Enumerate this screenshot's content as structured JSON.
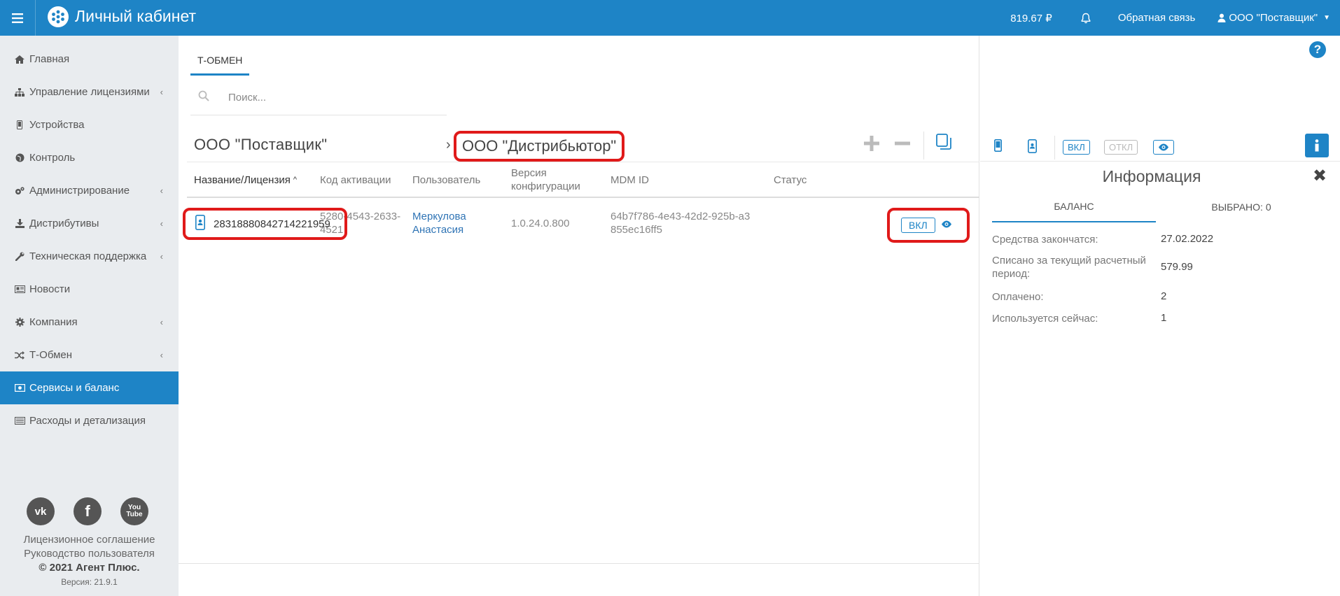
{
  "topbar": {
    "title": "Личный кабинет",
    "balance": "819.67 ₽",
    "feedback": "Обратная связь",
    "user": "ООО \"Поставщик\""
  },
  "sidebar": {
    "items": [
      {
        "label": "Главная",
        "icon": "home-icon",
        "chevron": false
      },
      {
        "label": "Управление лицензиями",
        "icon": "sitemap-icon",
        "chevron": true
      },
      {
        "label": "Устройства",
        "icon": "mobile-icon",
        "chevron": false
      },
      {
        "label": "Контроль",
        "icon": "globe-icon",
        "chevron": false
      },
      {
        "label": "Администрирование",
        "icon": "cogs-icon",
        "chevron": true
      },
      {
        "label": "Дистрибутивы",
        "icon": "download-icon",
        "chevron": true
      },
      {
        "label": "Техническая поддержка",
        "icon": "wrench-icon",
        "chevron": true
      },
      {
        "label": "Новости",
        "icon": "newspaper-icon",
        "chevron": false
      },
      {
        "label": "Компания",
        "icon": "gear-icon",
        "chevron": true
      },
      {
        "label": "Т-Обмен",
        "icon": "random-icon",
        "chevron": true
      },
      {
        "label": "Сервисы и баланс",
        "icon": "money-icon",
        "chevron": false,
        "active": true
      },
      {
        "label": "Расходы и детализация",
        "icon": "list-icon",
        "chevron": false
      }
    ],
    "socials": [
      "vk-icon",
      "facebook-icon",
      "youtube-icon"
    ],
    "footer": {
      "license": "Лицензионное соглашение",
      "guide": "Руководство пользователя",
      "copyright": "© 2021 Агент Плюс.",
      "version": "Версия: 21.9.1"
    }
  },
  "main": {
    "tab": "Т-ОБМЕН",
    "search_placeholder": "Поиск...",
    "breadcrumb_left": "ООО \"Поставщик\"",
    "breadcrumb_sep": "›",
    "breadcrumb_right": "ООО \"Дистрибьютор\"",
    "columns": {
      "name": "Название/Лицензия",
      "code": "Код активации",
      "user": "Пользователь",
      "version": "Версия конфигурации",
      "mdm": "MDM ID",
      "status": "Статус"
    },
    "row": {
      "license": "28318880842714221959",
      "code": "5280-4543-2633-4521",
      "user": "Меркулова Анастасия",
      "version": "1.0.24.0.800",
      "mdm": "64b7f786-4e43-42d2-925b-a3855ec16ff5",
      "status": "ВКЛ"
    }
  },
  "right": {
    "btn_on": "ВКЛ",
    "btn_off": "ОТКЛ",
    "title": "Информация",
    "tab_balance": "БАЛАНС",
    "tab_selected": "ВЫБРАНО: 0",
    "rows": [
      {
        "label": "Средства закончатся:",
        "value": "27.02.2022"
      },
      {
        "label": "Списано за текущий расчетный период:",
        "value": "579.99"
      },
      {
        "label": "Оплачено:",
        "value": "2"
      },
      {
        "label": "Используется сейчас:",
        "value": "1"
      }
    ]
  },
  "colors": {
    "accent": "#1e84c6",
    "highlight": "#e01a1a",
    "sidebar_bg": "#e9ecef"
  }
}
